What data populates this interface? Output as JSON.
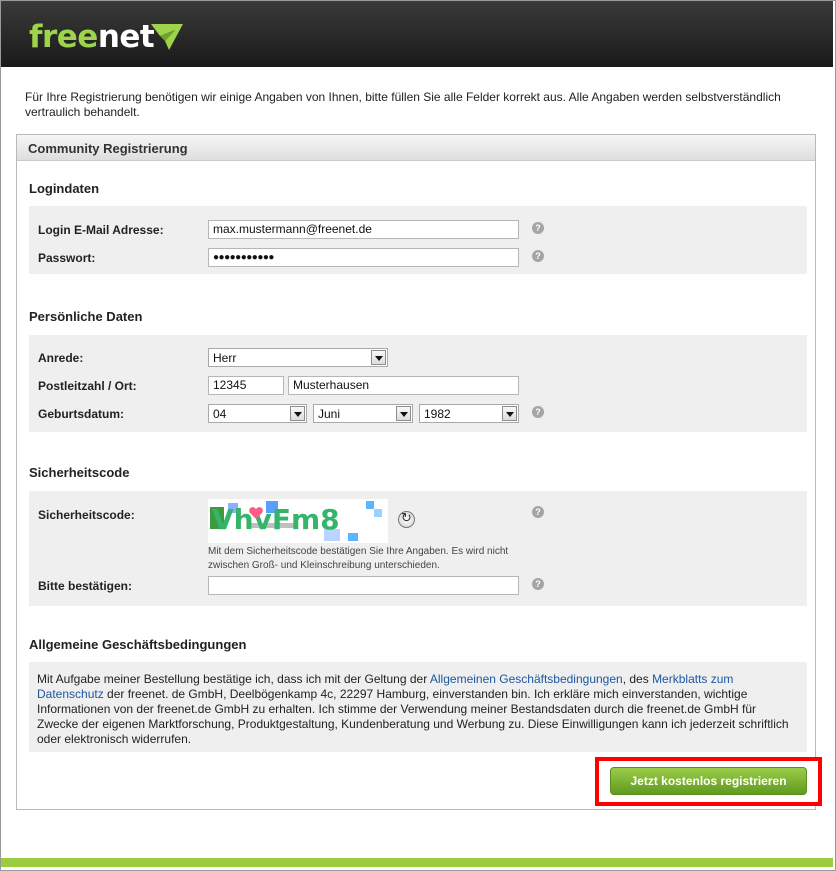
{
  "brand": {
    "word_a": "free",
    "word_b": "net",
    "accent": "#9dd44a"
  },
  "intro": "Für Ihre Registrierung benötigen wir einige Angaben von Ihnen, bitte füllen Sie alle Felder korrekt aus. Alle Angaben werden selbstverständlich vertraulich behandelt.",
  "panel_title": "Community Registrierung",
  "login": {
    "title": "Logindaten",
    "email_label": "Login E-Mail Adresse:",
    "email_value": "max.mustermann@freenet.de",
    "password_label": "Passwort:",
    "password_value": "●●●●●●●●●●●"
  },
  "personal": {
    "title": "Persönliche Daten",
    "salutation_label": "Anrede:",
    "salutation_value": "Herr",
    "zip_label": "Postleitzahl / Ort:",
    "zip_value": "12345",
    "city_value": "Musterhausen",
    "birth_label": "Geburtsdatum:",
    "birth_day": "04",
    "birth_month": "Juni",
    "birth_year": "1982"
  },
  "security": {
    "title": "Sicherheitscode",
    "code_label": "Sicherheitscode:",
    "captcha_text": "VhvFm8",
    "hint": "Mit dem Sicherheitscode bestätigen Sie Ihre Angaben. Es wird nicht zwischen Groß- und Kleinschreibung unterschieden.",
    "confirm_label": "Bitte bestätigen:",
    "confirm_value": ""
  },
  "agb": {
    "title": "Allgemeine Geschäftsbedingungen",
    "text_1": "Mit Aufgabe meiner Bestellung bestätige ich, dass ich mit der Geltung der ",
    "link_1": "Allgemeinen Geschäftsbedingungen",
    "text_2": ", des ",
    "link_2": "Merkblatts zum Datenschutz",
    "text_3": " der freenet. de GmbH, Deelbögenkamp 4c, 22297 Hamburg, einverstanden bin. Ich erkläre mich einverstanden, wichtige Informationen von der freenet.de GmbH zu erhalten. Ich stimme der Verwendung meiner Bestandsdaten durch die freenet.de GmbH für Zwecke der eigenen Marktforschung, Produktgestaltung, Kundenberatung und Werbung zu. Diese Einwilligungen kann ich jederzeit schriftlich oder elektronisch widerrufen."
  },
  "submit_label": "Jetzt kostenlos registrieren",
  "help_glyph": "?",
  "colors": {
    "link": "#1d57a0",
    "highlight": "#ff0000",
    "button": "#7cb534"
  }
}
